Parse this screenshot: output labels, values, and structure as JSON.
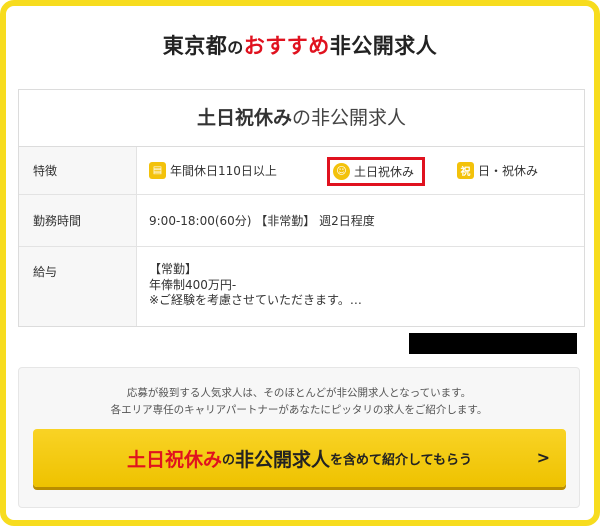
{
  "header": {
    "region": "東京都",
    "particle": "の",
    "highlight": "おすすめ",
    "suffix": "非公開求人"
  },
  "job": {
    "title_bold": "土日祝休み",
    "title_rest": "の非公開求人",
    "rows": {
      "features_label": "特徴",
      "hours_label": "勤務時間",
      "salary_label": "給与"
    },
    "features": [
      {
        "label": "年間休日110日以上",
        "icon": "calendar-icon"
      },
      {
        "label": "土日祝休み",
        "icon": "smile-icon"
      },
      {
        "label": "日・祝休み",
        "icon": "holiday-icon"
      }
    ],
    "hours": "9:00-18:00(60分) 【非常勤】 週2日程度",
    "salary": {
      "line1": "【常勤】",
      "line2": "年俸制400万円-",
      "line3": "※ご経験を考慮させていただきます。…"
    }
  },
  "cta": {
    "info_line1": "応募が殺到する人気求人は、そのほとんどが非公開求人となっています。",
    "info_line2": "各エリア専任のキャリアパートナーがあなたにピッタリの求人をご紹介します。",
    "button_part1": "土日祝休み",
    "button_part2": "の",
    "button_part3": "非公開求人",
    "button_part4": "を含めて紹介してもらう",
    "button_icon": "chevron-right-icon"
  },
  "colors": {
    "frame": "#f7dc1e",
    "accent_red": "#e0121f",
    "button_yellow": "#f5cb10"
  }
}
